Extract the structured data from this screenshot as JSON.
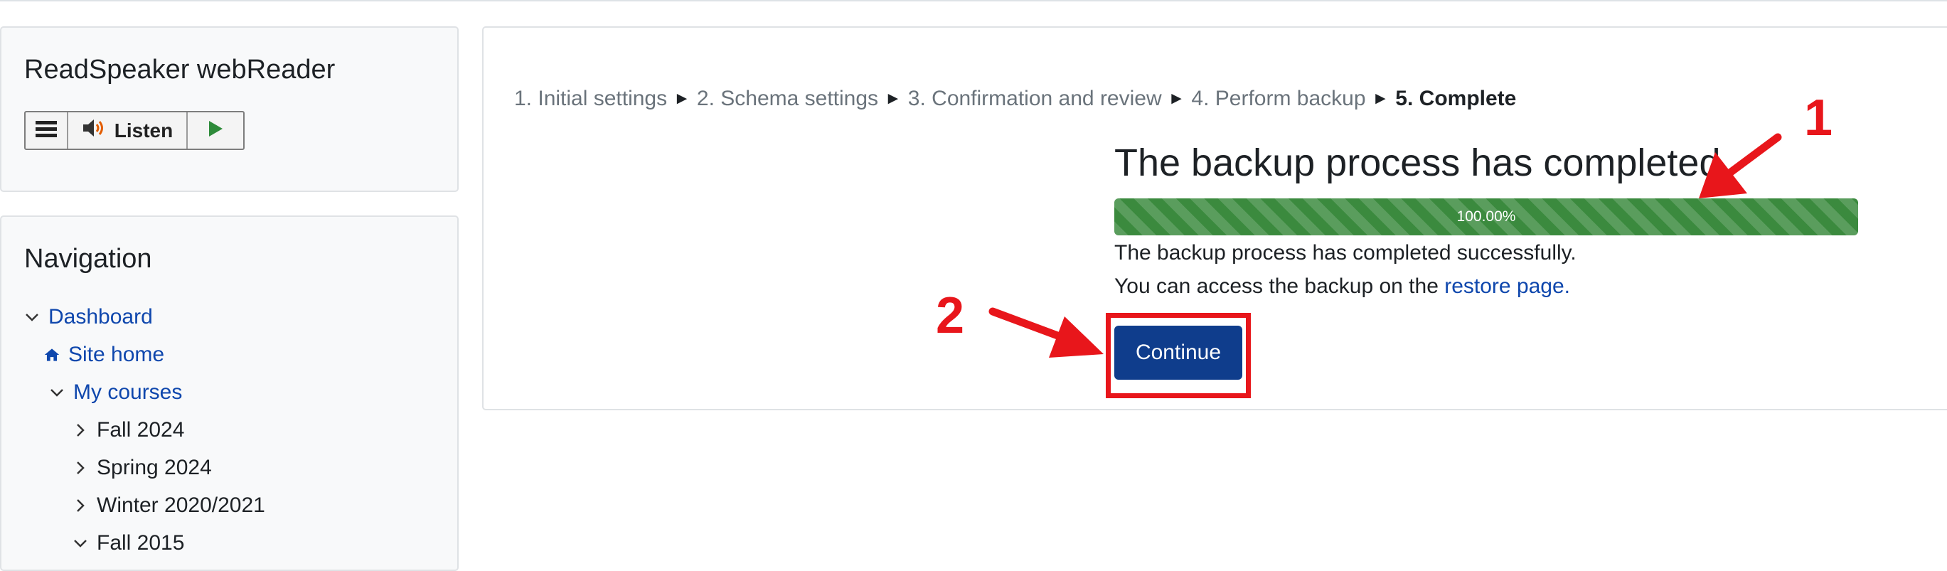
{
  "sidebar": {
    "readspeaker": {
      "title": "ReadSpeaker webReader",
      "listen_label": "Listen"
    },
    "navigation": {
      "title": "Navigation",
      "items": [
        {
          "label": "Dashboard",
          "expanded": true,
          "link": true,
          "icon": "chevron-down-icon"
        },
        {
          "label": "Site home",
          "link": true,
          "icon": "home-icon"
        },
        {
          "label": "My courses",
          "expanded": true,
          "link": true,
          "icon": "chevron-down-icon"
        },
        {
          "label": "Fall 2024",
          "expanded": false,
          "link": false,
          "icon": "chevron-right-icon"
        },
        {
          "label": "Spring 2024",
          "expanded": false,
          "link": false,
          "icon": "chevron-right-icon"
        },
        {
          "label": "Winter 2020/2021",
          "expanded": false,
          "link": false,
          "icon": "chevron-right-icon"
        },
        {
          "label": "Fall 2015",
          "expanded": true,
          "link": false,
          "icon": "chevron-down-icon"
        }
      ]
    }
  },
  "main": {
    "breadcrumb": {
      "steps": [
        "1. Initial settings",
        "2. Schema settings",
        "3. Confirmation and review",
        "4. Perform backup",
        "5. Complete"
      ],
      "separator": "►"
    },
    "heading": "The backup process has completed",
    "progress": {
      "value": 100,
      "label": "100.00%",
      "color": "#3b8a3e"
    },
    "message_1": "The backup process has completed successfully.",
    "message_2_prefix": "You can access the backup on the",
    "message_2_link": "restore page.",
    "continue_label": "Continue"
  },
  "annotations": {
    "label_1": "1",
    "label_2": "2",
    "color": "#e8161b"
  }
}
